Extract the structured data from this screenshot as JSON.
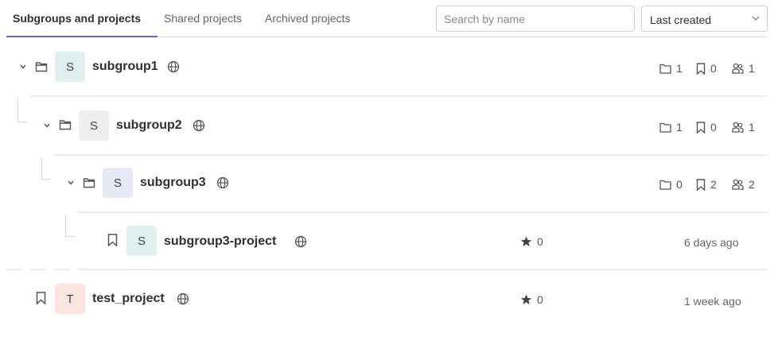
{
  "tabs": [
    {
      "label": "Subgroups and projects",
      "active": true
    },
    {
      "label": "Shared projects",
      "active": false
    },
    {
      "label": "Archived projects",
      "active": false
    }
  ],
  "search": {
    "placeholder": "Search by name",
    "value": ""
  },
  "sort": {
    "selected": "Last created"
  },
  "rows": [
    {
      "type": "group",
      "name": "subgroup1",
      "avatar_letter": "S",
      "avatar_color": "#e0f0ef",
      "subgroups": "1",
      "projects": "0",
      "members": "1",
      "visibility_icon": "globe-icon"
    },
    {
      "type": "group",
      "name": "subgroup2",
      "avatar_letter": "S",
      "avatar_color": "#eeeeee",
      "subgroups": "1",
      "projects": "0",
      "members": "1",
      "visibility_icon": "globe-icon"
    },
    {
      "type": "group",
      "name": "subgroup3",
      "avatar_letter": "S",
      "avatar_color": "#e8e9f6",
      "subgroups": "0",
      "projects": "2",
      "members": "2",
      "visibility_icon": "globe-icon"
    },
    {
      "type": "project",
      "name": "subgroup3-project",
      "avatar_letter": "S",
      "avatar_color": "#e0f0ef",
      "stars": "0",
      "updated": "6 days ago",
      "visibility_icon": "globe-icon"
    },
    {
      "type": "project",
      "name": "test_project",
      "avatar_letter": "T",
      "avatar_color": "#fbe5e1",
      "stars": "0",
      "updated": "1 week ago",
      "visibility_icon": "globe-icon"
    }
  ],
  "colors": {
    "tab_accent": "#6666c4",
    "border": "#dbdbdb"
  }
}
